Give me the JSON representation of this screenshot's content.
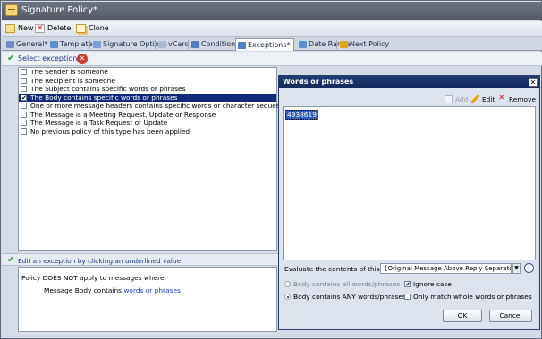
{
  "window": {
    "title": "Signature Policy*"
  },
  "toolbar": {
    "new": "New",
    "delete": "Delete",
    "clone": "Clone"
  },
  "tabs": [
    {
      "label": "General*"
    },
    {
      "label": "Template"
    },
    {
      "label": "Signature Options"
    },
    {
      "label": "vCard"
    },
    {
      "label": "Conditions"
    },
    {
      "label": "Exceptions*"
    },
    {
      "label": "Date Range"
    },
    {
      "label": "Next Policy"
    }
  ],
  "exceptions": {
    "header": "Select exception(s)",
    "items": [
      {
        "label": "The Sender is someone",
        "checked": false
      },
      {
        "label": "The Recipient is someone",
        "checked": false
      },
      {
        "label": "The Subject contains specific words or phrases",
        "checked": false
      },
      {
        "label": "The Body contains specific words or phrases",
        "checked": true
      },
      {
        "label": "One or more message headers contains specific words or character sequences",
        "checked": false
      },
      {
        "label": "The Message is a Meeting Request, Update or Response",
        "checked": false
      },
      {
        "label": "The Message is a Task Request or Update",
        "checked": false
      },
      {
        "label": "No previous policy of this type has been applied",
        "checked": false
      }
    ],
    "check_mark": "✔"
  },
  "edit_exception": {
    "header": "Edit an exception by clicking an underlined value",
    "line1": "Policy DOES NOT apply to messages where:",
    "line2_prefix": "Message Body contains ",
    "line2_link": "words or phrases"
  },
  "dialog": {
    "title": "Words or phrases",
    "close": "✕",
    "add": "Add",
    "edit": "Edit",
    "remove": "Remove",
    "value": "4938619",
    "evaluate_label": "Evaluate the contents of this field:",
    "evaluate_value": "{Original Message Above Reply Separator}",
    "info": "i",
    "dropdown_arrow": "▼",
    "options": {
      "all": "Body contains all words/phrases",
      "any": "Body contains ANY words/phrases",
      "ignore_case": "Ignore case",
      "whole_words": "Only match whole words or phrases"
    },
    "ok": "OK",
    "cancel": "Cancel"
  },
  "colors": {
    "selection": "#0f2b77",
    "titlebar": "#555b66",
    "dialog_title": "#14295a"
  }
}
